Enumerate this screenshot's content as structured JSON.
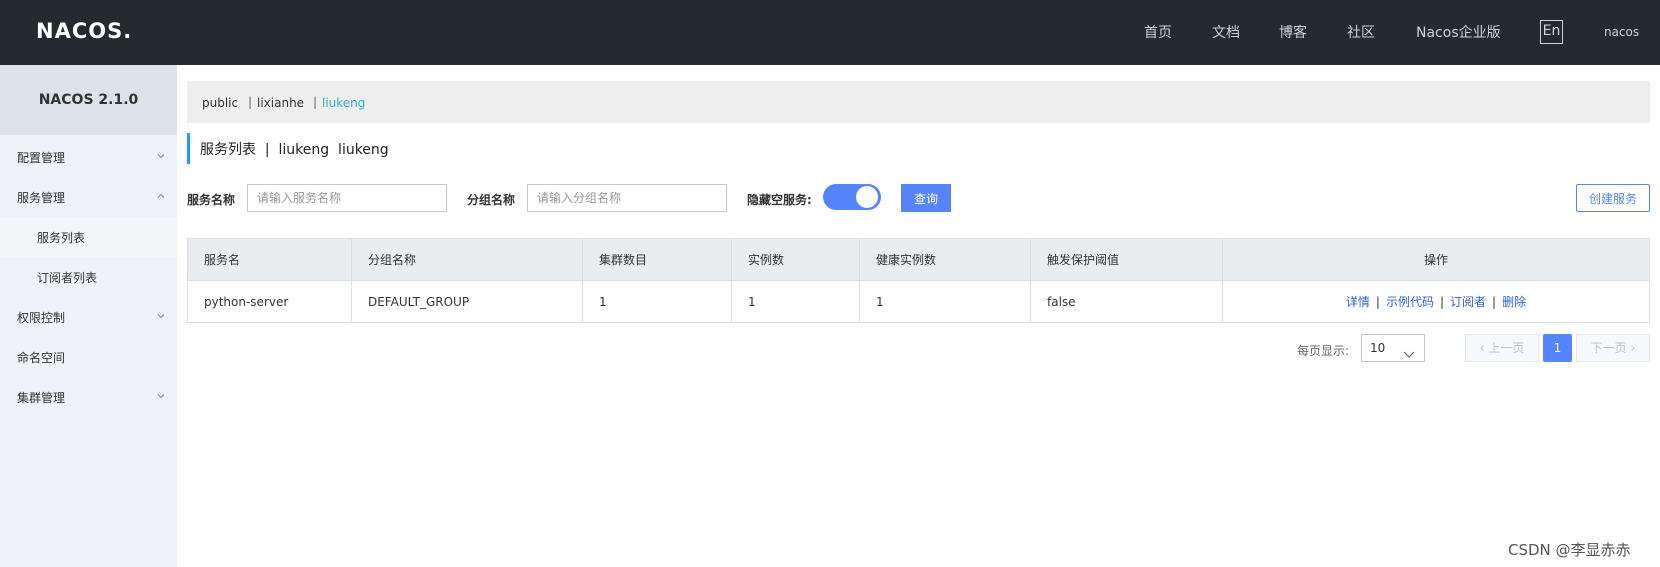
{
  "header": {
    "logo": "NACOS.",
    "nav": [
      "首页",
      "文档",
      "博客",
      "社区",
      "Nacos企业版"
    ],
    "lang": "En",
    "user": "nacos"
  },
  "sidebar": {
    "title": "NACOS 2.1.0",
    "items": [
      {
        "label": "配置管理",
        "chevron": "down"
      },
      {
        "label": "服务管理",
        "chevron": "up"
      },
      {
        "label": "服务列表",
        "sub": true,
        "active": true
      },
      {
        "label": "订阅者列表",
        "sub": true
      },
      {
        "label": "权限控制",
        "chevron": "down"
      },
      {
        "label": "命名空间"
      },
      {
        "label": "集群管理",
        "chevron": "down"
      }
    ]
  },
  "namespaces": {
    "items": [
      "public",
      "lixianhe",
      "liukeng"
    ],
    "separator": "|",
    "active": "liukeng"
  },
  "page": {
    "title": "服务列表  |  liukeng  liukeng"
  },
  "filters": {
    "service_label": "服务名称",
    "service_placeholder": "请输入服务名称",
    "group_label": "分组名称",
    "group_placeholder": "请输入分组名称",
    "hide_empty_label": "隐藏空服务:",
    "hide_empty": true,
    "query_label": "查询",
    "create_label": "创建服务"
  },
  "table": {
    "headers": [
      "服务名",
      "分组名称",
      "集群数目",
      "实例数",
      "健康实例数",
      "触发保护阈值",
      "操作"
    ],
    "rows": [
      {
        "cells": [
          "python-server",
          "DEFAULT_GROUP",
          "1",
          "1",
          "1",
          "false"
        ],
        "ops": [
          "详情",
          "示例代码",
          "订阅者",
          "删除"
        ]
      }
    ]
  },
  "pagination": {
    "page_size_label": "每页显示:",
    "page_size": "10",
    "prev_label": "上一页",
    "next_label": "下一页",
    "current_page": "1"
  },
  "watermark": "CSDN @李显赤赤",
  "colors": {
    "header_bg": "#252a2f",
    "primary": "#5584ff",
    "active_ns": "#2fb0d5",
    "link": "#2e62d9"
  }
}
